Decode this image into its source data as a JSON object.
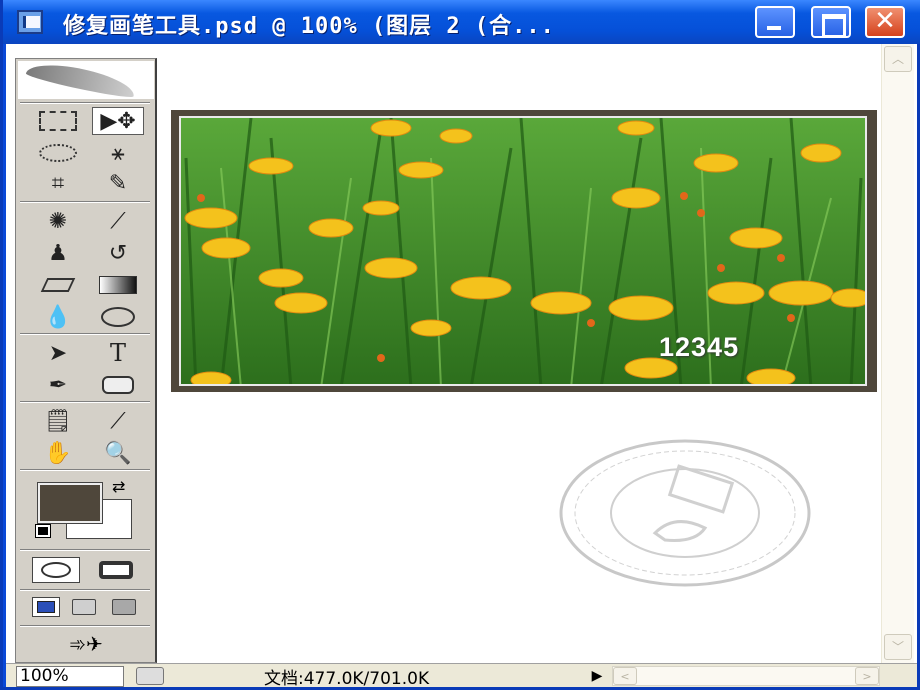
{
  "window": {
    "title": "修复画笔工具.psd @ 100% (图层 2 (合...",
    "close_glyph": "✕"
  },
  "toolbox": {
    "text_tool_glyph": "T"
  },
  "canvas": {
    "photo_watermark": "12345"
  },
  "status": {
    "zoom": "100%",
    "doc_size": "文档:477.0K/701.0K"
  },
  "colors": {
    "titlebar": "#0858e0",
    "foreground": "#4f473b",
    "background": "#ffffff",
    "frame": "#4f473b"
  },
  "icons": [
    "app-icon",
    "feather-icon",
    "marquee-icon",
    "move-icon",
    "lasso-icon",
    "magic-wand-icon",
    "crop-icon",
    "slice-icon",
    "healing-brush-icon",
    "brush-icon",
    "clone-stamp-icon",
    "history-brush-icon",
    "eraser-icon",
    "gradient-icon",
    "blur-icon",
    "dodge-icon",
    "path-select-icon",
    "type-icon",
    "pen-icon",
    "shape-icon",
    "notes-icon",
    "eyedropper-icon",
    "hand-icon",
    "zoom-icon",
    "swap-colors-icon",
    "default-colors-icon",
    "standard-mode-icon",
    "quickmask-mode-icon",
    "screen-mode-icon",
    "jump-to-imageready-icon",
    "seal-stamp"
  ]
}
